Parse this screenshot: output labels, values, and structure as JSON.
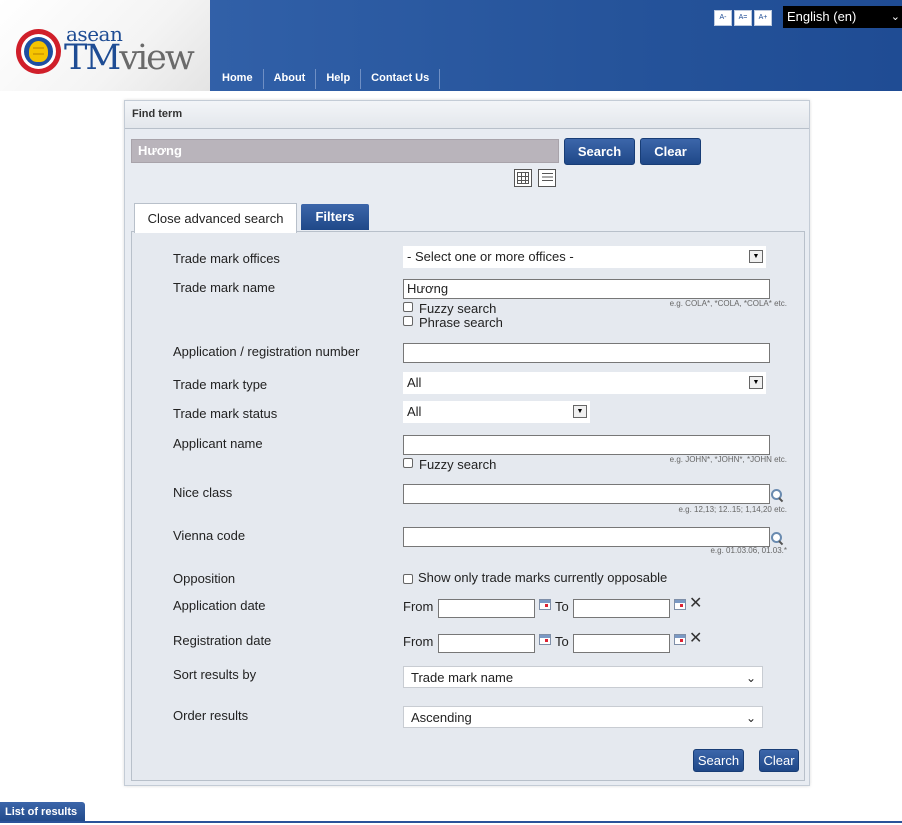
{
  "header": {
    "logo_asean": "asean",
    "logo_tm": "TM",
    "logo_view": "view",
    "nav": [
      "Home",
      "About",
      "Help",
      "Contact Us"
    ],
    "font_tools": [
      "A-",
      "A=",
      "A+"
    ],
    "language": "English (en)"
  },
  "search": {
    "panel_title": "Find term",
    "term_value": "Hương",
    "search_label": "Search",
    "clear_label": "Clear"
  },
  "tabs": {
    "advanced": "Close advanced search",
    "filters": "Filters"
  },
  "form": {
    "offices_label": "Trade mark offices",
    "offices_value": "- Select one or more offices -",
    "name_label": "Trade mark name",
    "name_value": "Hương",
    "fuzzy_label": "Fuzzy search",
    "phrase_label": "Phrase search",
    "name_hint": "e.g. COLA*, *COLA, *COLA* etc.",
    "appnum_label": "Application / registration number",
    "type_label": "Trade mark type",
    "type_value": "All",
    "status_label": "Trade mark status",
    "status_value": "All",
    "applicant_label": "Applicant name",
    "applicant_fuzzy_label": "Fuzzy search",
    "applicant_hint": "e.g. JOHN*, *JOHN*, *JOHN etc.",
    "nice_label": "Nice class",
    "nice_hint": "e.g. 12,13; 12..15; 1,14,20 etc.",
    "vienna_label": "Vienna code",
    "vienna_hint": "e.g. 01.03.06, 01.03.*",
    "opposition_label": "Opposition",
    "opposition_option": "Show only trade marks currently opposable",
    "appdate_label": "Application date",
    "regdate_label": "Registration date",
    "from_label": "From",
    "to_label": "To",
    "sort_label": "Sort results by",
    "sort_value": "Trade mark name",
    "order_label": "Order results",
    "order_value": "Ascending",
    "search_label": "Search",
    "clear_label": "Clear"
  },
  "results": {
    "tab_label": "List of results"
  }
}
